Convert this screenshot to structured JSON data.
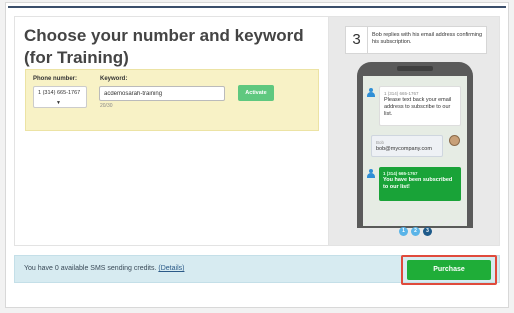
{
  "heading": "Choose your number and keyword (for Training)",
  "form": {
    "phone_label": "Phone number:",
    "phone_value": "1 (314) 665-1767",
    "keyword_label": "Keyword:",
    "keyword_value": "acdemosarah-training",
    "keyword_counter": "20/30",
    "activate_label": "Activate"
  },
  "preview": {
    "step_number": "3",
    "step_text": "Bob replies with his email address confirming his subscription.",
    "messages": [
      {
        "from": "1 (314) 665-1767",
        "body": "Please text back your email address to subscribe to our list."
      },
      {
        "from": "Bob",
        "body": "bob@mycompany.com"
      },
      {
        "from": "1 (314) 665-1767",
        "body": "You have been subscribed to our list!"
      }
    ],
    "pager": [
      "1",
      "2",
      "3"
    ],
    "pager_active": "3"
  },
  "credits": {
    "text": "You have 0 available SMS sending credits.",
    "details_label": "(Details)"
  },
  "purchase_label": "Purchase",
  "colors": {
    "accent_green": "#1fad38",
    "highlight_red": "#e04a3c",
    "form_bg": "#f8f2c6",
    "info_bar_bg": "#d7ebf1"
  },
  "icons": [
    "caret-down-icon",
    "user-icon",
    "avatar-icon"
  ]
}
